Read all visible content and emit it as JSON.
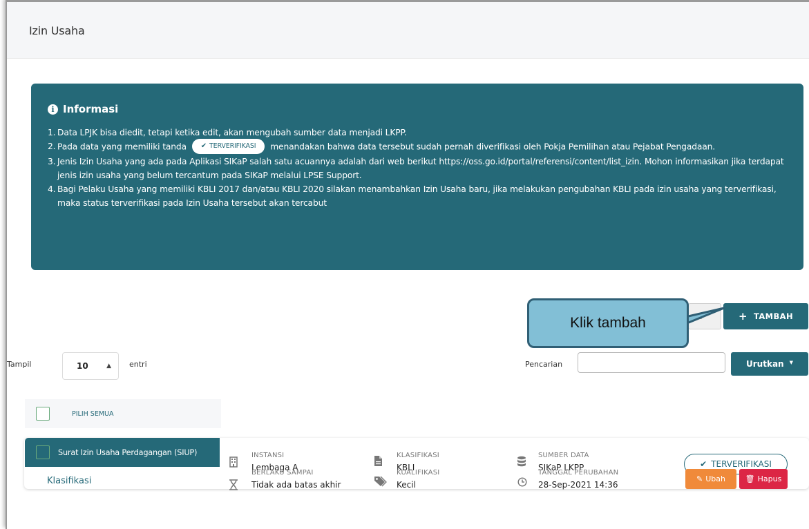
{
  "page": {
    "title": "Izin Usaha"
  },
  "info": {
    "heading": "Informasi",
    "items": [
      {
        "num": "1.",
        "text": "Data LPJK bisa diedit, tetapi ketika edit, akan mengubah sumber data menjadi LKPP."
      },
      {
        "num": "2.",
        "text_before": "Pada data yang memiliki tanda",
        "badge": "TERVERIFIKASI",
        "text_after": "menandakan bahwa data tersebut sudah pernah diverifikasi oleh Pokja Pemilihan atau Pejabat Pengadaan."
      },
      {
        "num": "3.",
        "text": "Jenis Izin Usaha yang ada pada Aplikasi SIKaP salah satu acuannya adalah dari web berikut https://oss.go.id/portal/referensi/content/list_izin. Mohon informasikan jika terdapat jenis izin usaha yang belum tercantum pada SIKaP melalui LPSE Support."
      },
      {
        "num": "4.",
        "text": "Bagi Pelaku Usaha yang memiliki KBLI 2017 dan/atau KBLI 2020 silakan menambahkan Izin Usaha baru, jika melakukan pengubahan KBLI pada izin usaha yang terverifikasi, maka status terverifikasi pada Izin Usaha tersebut akan tercabut"
      }
    ]
  },
  "actions": {
    "hidden_partial": "L",
    "tambah_label": "TAMBAH",
    "callout": "Klik tambah"
  },
  "controls": {
    "tampil_label": "Tampil",
    "page_size": "10",
    "entri_label": "entri",
    "search_label": "Pencarian",
    "search_value": "",
    "sort_label": "Urutkan"
  },
  "select_all": {
    "label": "PILIH SEMUA"
  },
  "record": {
    "name": "Surat Izin Usaha Perdagangan (SIUP)",
    "link": "Klasifikasi",
    "instansi_label": "INSTANSI",
    "instansi_value": "Lembaga A",
    "berlaku_label": "BERLAKU SAMPAI",
    "berlaku_value": "Tidak ada batas akhir",
    "klasifikasi_label": "KLASIFIKASI",
    "klasifikasi_value": "KBLI",
    "kualifikasi_label": "KUALIFIKASI",
    "kualifikasi_value": "Kecil",
    "sumber_label": "SUMBER DATA",
    "sumber_value": "SIKaP LKPP",
    "tanggal_label": "TANGGAL PERUBAHAN",
    "tanggal_value": "28-Sep-2021 14:36",
    "status": "TERVERIFIKASI",
    "edit_label": "Ubah",
    "delete_label": "Hapus"
  },
  "colors": {
    "primary": "#256978",
    "warning": "#f08a3a",
    "danger": "#dc2645",
    "callout": "#82bfd6"
  },
  "icons": [
    "info-icon",
    "check-icon",
    "plus-icon",
    "sort-arrows-icon",
    "caret-down-icon",
    "building-icon",
    "hourglass-icon",
    "file-icon",
    "tag-icon",
    "database-icon",
    "clock-icon",
    "edit-icon",
    "trash-icon"
  ]
}
